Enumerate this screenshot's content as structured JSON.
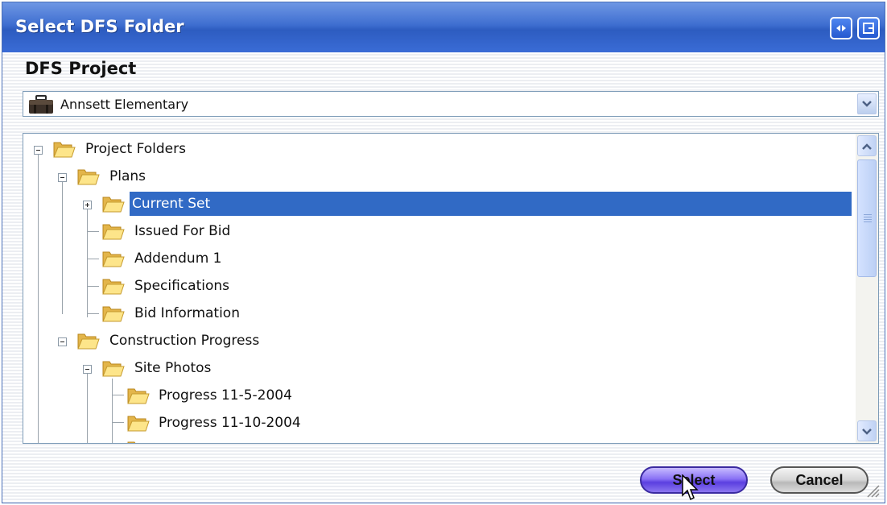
{
  "window": {
    "title": "Select DFS Folder",
    "colors": {
      "titlebar": "#3e6ed0",
      "selection": "#316ac5"
    }
  },
  "project": {
    "heading": "DFS Project",
    "selected": "Annsett Elementary",
    "icon": "briefcase-icon"
  },
  "tree": {
    "items": [
      {
        "label": "Project Folders",
        "expander": "minus"
      },
      {
        "label": "Plans",
        "expander": "minus"
      },
      {
        "label": "Current Set",
        "expander": "plus",
        "selected": true
      },
      {
        "label": "Issued For Bid"
      },
      {
        "label": "Addendum 1"
      },
      {
        "label": "Specifications"
      },
      {
        "label": "Bid Information"
      },
      {
        "label": "Construction Progress",
        "expander": "minus"
      },
      {
        "label": "Site Photos",
        "expander": "minus"
      },
      {
        "label": "Progress 11-5-2004"
      },
      {
        "label": "Progress 11-10-2004"
      }
    ]
  },
  "buttons": {
    "select": "Select",
    "cancel": "Cancel"
  }
}
